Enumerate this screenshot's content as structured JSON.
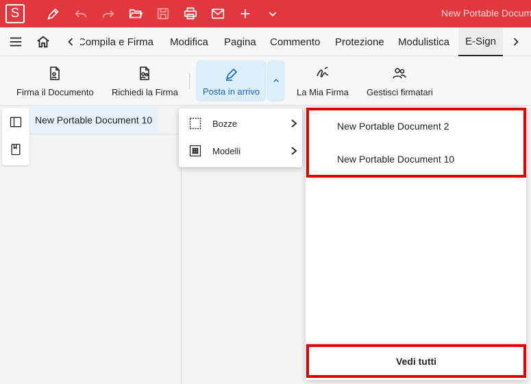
{
  "app": {
    "logo_letter": "S",
    "document_title": "New Portable Docum"
  },
  "tabs": [
    {
      "label": "Compila e Firma",
      "active": false
    },
    {
      "label": "Modifica",
      "active": false
    },
    {
      "label": "Pagina",
      "active": false
    },
    {
      "label": "Commento",
      "active": false
    },
    {
      "label": "Protezione",
      "active": false
    },
    {
      "label": "Modulistica",
      "active": false
    },
    {
      "label": "E-Sign",
      "active": true
    }
  ],
  "ribbon": {
    "sign_document": "Firma il Documento",
    "request_signature": "Richiedi la Firma",
    "inbox": "Posta in arrivo",
    "my_signature": "La Mia Firma",
    "manage_signers": "Gestisci firmatari"
  },
  "document_tab": {
    "label": "New Portable Document 10"
  },
  "submenu": {
    "items": [
      {
        "label": "Bozze",
        "icon": "dashed-square-icon"
      },
      {
        "label": "Modelli",
        "icon": "dotted-grid-icon"
      }
    ]
  },
  "flyout": {
    "recent": [
      {
        "label": "New Portable Document 2"
      },
      {
        "label": "New Portable Document 10"
      }
    ],
    "see_all": "Vedi tutti"
  },
  "colors": {
    "titlebar": "#e0383e",
    "accent_blue": "#1565c0",
    "highlight_red": "#e00000",
    "active_bg": "#dceefa"
  }
}
